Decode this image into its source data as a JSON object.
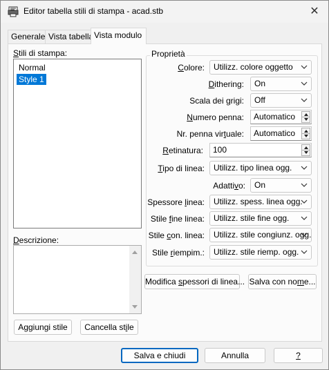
{
  "window": {
    "title": "Editor tabella stili di stampa - acad.stb",
    "close_glyph": "✕"
  },
  "tabs": [
    {
      "label": "Generale",
      "active": false
    },
    {
      "label": "Vista tabella",
      "active": false
    },
    {
      "label": "Vista modulo",
      "active": true
    }
  ],
  "styles_list": {
    "label_pre": "",
    "label_mn": "S",
    "label_post": "tili di stampa:",
    "items": [
      {
        "label": "Normal",
        "selected": false
      },
      {
        "label": "Style 1",
        "selected": true
      }
    ]
  },
  "description": {
    "label_pre": "",
    "label_mn": "D",
    "label_post": "escrizione:",
    "value": ""
  },
  "left_buttons": {
    "add": {
      "pre": "A",
      "mn": "g",
      "post": "giungi stile"
    },
    "delete": {
      "pre": "Cancella st",
      "mn": "i",
      "post": "le"
    }
  },
  "properties": {
    "group_title": "Proprietà",
    "color": {
      "pre": "",
      "mn": "C",
      "post": "olore:",
      "value": "Utilizz. colore oggetto"
    },
    "dithering": {
      "pre": "",
      "mn": "D",
      "post": "ithering:",
      "value": "On"
    },
    "grayscale": {
      "pre": "Scala dei ",
      "mn": "g",
      "post": "rigi:",
      "value": "Off"
    },
    "pen_number": {
      "pre": "",
      "mn": "N",
      "post": "umero penna:",
      "value": "Automatico"
    },
    "virtual_pen": {
      "pre": "Nr. penna vir",
      "mn": "t",
      "post": "uale:",
      "value": "Automatico"
    },
    "screening": {
      "pre": "",
      "mn": "R",
      "post": "etinatura:",
      "value": "100"
    },
    "linetype": {
      "pre": "",
      "mn": "T",
      "post": "ipo di linea:",
      "value": "Utilizz. tipo linea ogg."
    },
    "adaptive": {
      "pre": "Adatti",
      "mn": "v",
      "post": "o:",
      "value": "On"
    },
    "lineweight": {
      "pre": "Spessore ",
      "mn": "l",
      "post": "inea:",
      "value": "Utilizz. spess. linea ogg."
    },
    "line_end": {
      "pre": "Stile ",
      "mn": "f",
      "post": "ine linea:",
      "value": "Utilizz. stile fine ogg."
    },
    "line_join": {
      "pre": "Stile ",
      "mn": "c",
      "post": "on. linea:",
      "value": "Utilizz. stile congiunz. ogg."
    },
    "fill": {
      "pre": "Stile ",
      "mn": "r",
      "post": "iempim.:",
      "value": "Utilizz. stile riemp. ogg."
    }
  },
  "mid_buttons": {
    "edit_lineweights": {
      "pre": "Modifica ",
      "mn": "s",
      "post": "pessori di linea..."
    },
    "save_as": {
      "pre": "Salva con no",
      "mn": "m",
      "post": "e..."
    }
  },
  "footer": {
    "save_close": "Salva e chiudi",
    "cancel": "Annulla",
    "help": "?"
  },
  "colors": {
    "accent": "#0078d7",
    "default_border": "#0067c0"
  }
}
